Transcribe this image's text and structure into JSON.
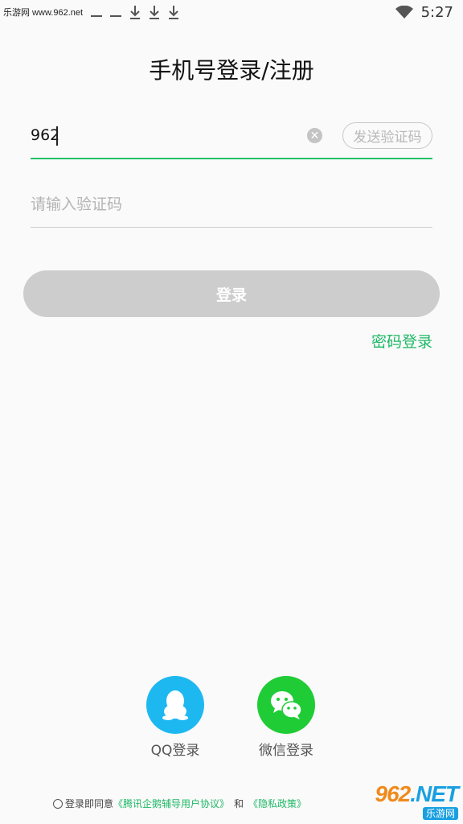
{
  "status_bar": {
    "watermark": "乐游网 www.962.net",
    "time": "5:27"
  },
  "title": "手机号登录/注册",
  "phone_field": {
    "value": "962",
    "send_code_label": "发送验证码"
  },
  "code_field": {
    "placeholder": "请输入验证码"
  },
  "login_button_label": "登录",
  "password_login_label": "密码登录",
  "social": {
    "qq_label": "QQ登录",
    "wechat_label": "微信登录"
  },
  "agreement": {
    "prefix": "登录即同意",
    "user_agreement": "《腾讯企鹅辅导用户协议》",
    "and": "和",
    "privacy": "《隐私政策》"
  },
  "corner_watermark": {
    "big_orange": "962",
    "big_blue": ".NET",
    "small": "乐游网"
  },
  "colors": {
    "accent_green": "#1fc26b",
    "qq_blue": "#1eb8f1",
    "wechat_green": "#1fcc36",
    "disabled_button": "#cdcdcd"
  }
}
